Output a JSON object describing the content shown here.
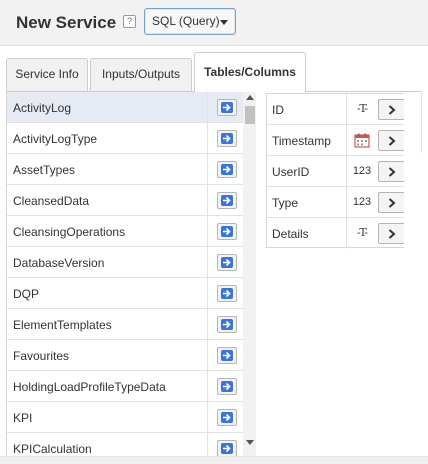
{
  "header": {
    "title": "New Service",
    "help_label": "?",
    "query_type": "SQL (Query)"
  },
  "tabs": [
    {
      "label": "Service Info",
      "active": false
    },
    {
      "label": "Inputs/Outputs",
      "active": false
    },
    {
      "label": "Tables/Columns",
      "active": true
    }
  ],
  "tables": {
    "selected": "ActivityLog",
    "items": [
      "ActivityLog",
      "ActivityLogType",
      "AssetTypes",
      "CleansedData",
      "CleansingOperations",
      "DatabaseVersion",
      "DQP",
      "ElementTemplates",
      "Favourites",
      "HoldingLoadProfileTypeData",
      "KPI",
      "KPICalculation"
    ]
  },
  "columns": [
    {
      "name": "ID",
      "type": "text",
      "type_symbol": "-T-"
    },
    {
      "name": "Timestamp",
      "type": "date",
      "type_symbol": "calendar-icon"
    },
    {
      "name": "UserID",
      "type": "number",
      "type_symbol": "123"
    },
    {
      "name": "Type",
      "type": "number",
      "type_symbol": "123"
    },
    {
      "name": "Details",
      "type": "text",
      "type_symbol": "-T-"
    }
  ],
  "colors": {
    "accent": "#3b75d8",
    "selected_row": "#e6ebf3",
    "dropdown_border": "#74a3c7"
  }
}
